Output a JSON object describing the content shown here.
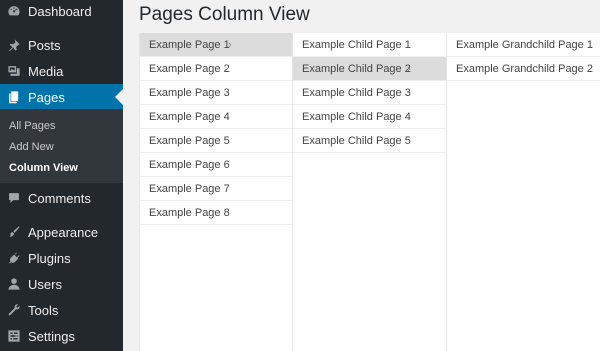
{
  "sidebar": {
    "items": [
      {
        "label": "Dashboard",
        "icon": "dashboard-icon"
      },
      {
        "label": "Posts",
        "icon": "pushpin-icon"
      },
      {
        "label": "Media",
        "icon": "media-icon"
      },
      {
        "label": "Pages",
        "icon": "pages-icon"
      },
      {
        "label": "Comments",
        "icon": "comments-icon"
      },
      {
        "label": "Appearance",
        "icon": "paintbrush-icon"
      },
      {
        "label": "Plugins",
        "icon": "plugins-icon"
      },
      {
        "label": "Users",
        "icon": "users-icon"
      },
      {
        "label": "Tools",
        "icon": "wrench-icon"
      },
      {
        "label": "Settings",
        "icon": "settings-icon"
      }
    ],
    "submenu": [
      {
        "label": "All Pages"
      },
      {
        "label": "Add New"
      },
      {
        "label": "Column View"
      }
    ]
  },
  "page": {
    "title": "Pages Column View"
  },
  "columns": [
    {
      "items": [
        "Example Page 1",
        "Example Page 2",
        "Example Page 3",
        "Example Page 4",
        "Example Page 5",
        "Example Page 6",
        "Example Page 7",
        "Example Page 8"
      ],
      "selected": "Example Page 1"
    },
    {
      "items": [
        "Example Child Page 1",
        "Example Child Page 2",
        "Example Child Page 3",
        "Example Child Page 4",
        "Example Child Page 5"
      ],
      "selected": "Example Child Page 2"
    },
    {
      "items": [
        "Example Grandchild Page 1",
        "Example Grandchild Page 2"
      ],
      "selected": null
    }
  ],
  "colors": {
    "sidebar_bg": "#23282d",
    "submenu_bg": "#32373c",
    "active_bg": "#0073aa",
    "page_bg": "#f1f1f1",
    "selected_row_bg": "#dcdcdc"
  }
}
